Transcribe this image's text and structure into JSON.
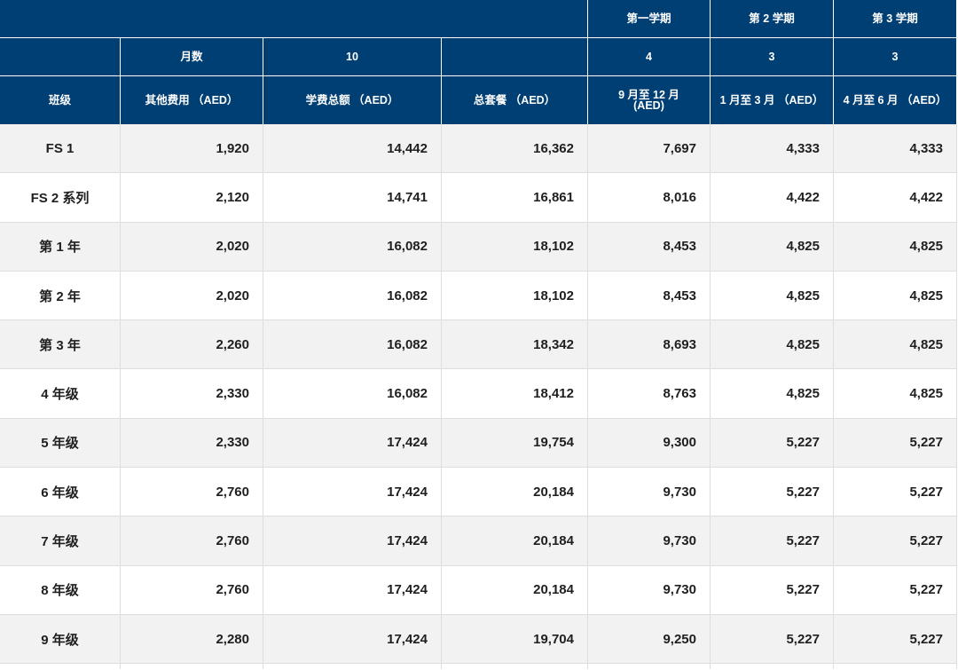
{
  "fee_table": {
    "header": {
      "terms": [
        "第一学期",
        "第 2 学期",
        "第 3 学期"
      ],
      "months_label": "月数",
      "months_total": "10",
      "term_months": [
        "4",
        "3",
        "3"
      ],
      "columns": [
        "班级",
        "其他费用 （AED）",
        "学费总额 （AED）",
        "总套餐 （AED）",
        "9 月至 12 月\n(AED)",
        "1 月至 3 月 （AED）",
        "4 月至 6 月 （AED）"
      ]
    },
    "rows": [
      {
        "grade": "FS 1",
        "other_fees": "1,920",
        "tuition_total": "14,442",
        "total_package": "16,362",
        "term_1": "7,697",
        "term_2": "4,333",
        "term_3": "4,333"
      },
      {
        "grade": "FS 2 系列",
        "other_fees": "2,120",
        "tuition_total": "14,741",
        "total_package": "16,861",
        "term_1": "8,016",
        "term_2": "4,422",
        "term_3": "4,422"
      },
      {
        "grade": "第 1 年",
        "other_fees": "2,020",
        "tuition_total": "16,082",
        "total_package": "18,102",
        "term_1": "8,453",
        "term_2": "4,825",
        "term_3": "4,825"
      },
      {
        "grade": "第 2 年",
        "other_fees": "2,020",
        "tuition_total": "16,082",
        "total_package": "18,102",
        "term_1": "8,453",
        "term_2": "4,825",
        "term_3": "4,825"
      },
      {
        "grade": "第 3 年",
        "other_fees": "2,260",
        "tuition_total": "16,082",
        "total_package": "18,342",
        "term_1": "8,693",
        "term_2": "4,825",
        "term_3": "4,825"
      },
      {
        "grade": "4 年级",
        "other_fees": "2,330",
        "tuition_total": "16,082",
        "total_package": "18,412",
        "term_1": "8,763",
        "term_2": "4,825",
        "term_3": "4,825"
      },
      {
        "grade": "5 年级",
        "other_fees": "2,330",
        "tuition_total": "17,424",
        "total_package": "19,754",
        "term_1": "9,300",
        "term_2": "5,227",
        "term_3": "5,227"
      },
      {
        "grade": "6 年级",
        "other_fees": "2,760",
        "tuition_total": "17,424",
        "total_package": "20,184",
        "term_1": "9,730",
        "term_2": "5,227",
        "term_3": "5,227"
      },
      {
        "grade": "7 年级",
        "other_fees": "2,760",
        "tuition_total": "17,424",
        "total_package": "20,184",
        "term_1": "9,730",
        "term_2": "5,227",
        "term_3": "5,227"
      },
      {
        "grade": "8 年级",
        "other_fees": "2,760",
        "tuition_total": "17,424",
        "total_package": "20,184",
        "term_1": "9,730",
        "term_2": "5,227",
        "term_3": "5,227"
      },
      {
        "grade": "9 年级",
        "other_fees": "2,280",
        "tuition_total": "17,424",
        "total_package": "19,704",
        "term_1": "9,250",
        "term_2": "5,227",
        "term_3": "5,227"
      }
    ]
  },
  "colors": {
    "header_bg": "#003f74",
    "header_text": "#ffffff",
    "header_line": "#ffffff",
    "row_bg": "#ffffff",
    "row_alt_bg": "#f2f2f2",
    "grid_line": "#dedede",
    "body_text": "#1f1f1f"
  }
}
